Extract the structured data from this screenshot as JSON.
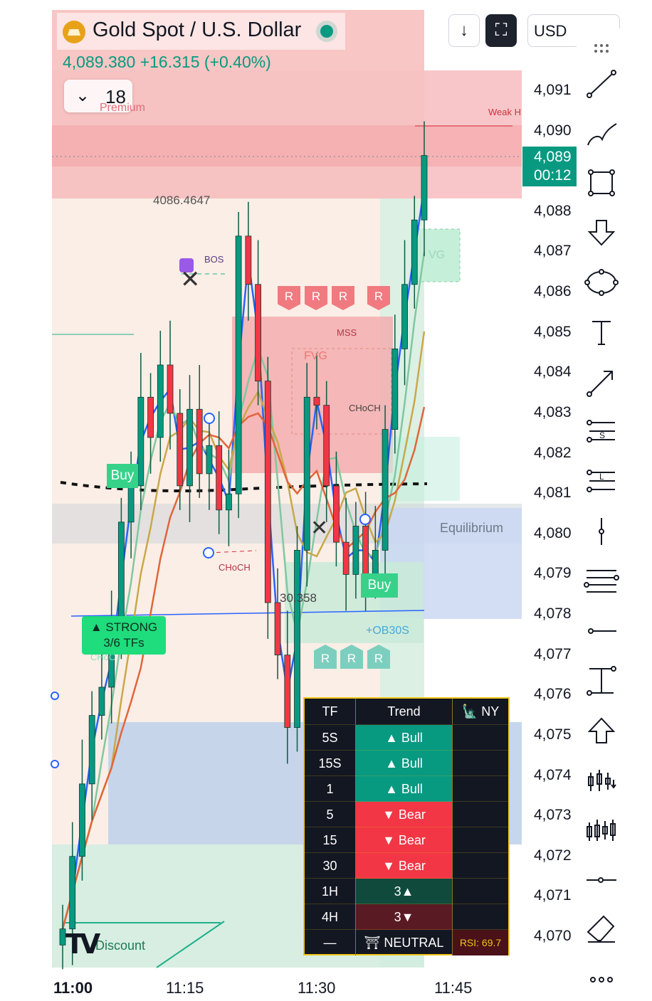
{
  "header": {
    "symbol_title": "Gold Spot / U.S. Dollar",
    "price_line": "4,089.380 +16.315 (+0.40%)",
    "interval": "18",
    "currency": "USD"
  },
  "price_tag": {
    "price": "4,089",
    "countdown": "00:12"
  },
  "colors": {
    "up": "#089981",
    "down": "#f23645",
    "ma_blue": "#2962ff",
    "accent_gold": "#f0c419"
  },
  "chart_data": {
    "type": "candlestick",
    "x_ticks": [
      "11:00",
      "11:15",
      "11:30",
      "11:45"
    ],
    "y_ticks": [
      "4,091",
      "4,090",
      "4,088",
      "4,087",
      "4,086",
      "4,085",
      "4,084",
      "4,083",
      "4,082",
      "4,081",
      "4,080",
      "4,079",
      "4,078",
      "4,077",
      "4,076",
      "4,075",
      "4,074",
      "4,073",
      "4,072",
      "4,071",
      "4,070"
    ],
    "ylim": [
      4069.3,
      4092.0
    ],
    "last_price": 4089.38,
    "close_path": [
      4070.2,
      4072.0,
      4073.8,
      4075.5,
      4076.2,
      4077.5,
      4080.3,
      4081.2,
      4083.4,
      4082.4,
      4084.2,
      4083.0,
      4081.2,
      4083.1,
      4081.5,
      4082.2,
      4080.6,
      4081.0,
      4087.4,
      4086.2,
      4083.8,
      4078.3,
      4077.0,
      4075.2,
      4079.6,
      4083.4,
      4083.2,
      4081.2,
      4079.8,
      4079.0,
      4080.2,
      4079.0,
      4079.6,
      4082.6,
      4084.6,
      4086.2,
      4087.8,
      4089.4
    ],
    "annotations": {
      "high_label": "4086.4647",
      "low_label": "30.358",
      "bos": "BOS",
      "mss": "MSS",
      "fvg_1": "FVG",
      "fvg_2": "VG",
      "choch_1": "CHoCH",
      "choch_2": "CHoCH",
      "choch_3": "CHoC",
      "ob": "+OB",
      "ob_tf": "30S",
      "buy_1": "Buy",
      "buy_2": "Buy",
      "equilibrium": "Equilibrium",
      "weak_high": "Weak H",
      "premium": "Premium",
      "discount": "Discount",
      "strong_line1": "▲ STRONG",
      "strong_line2": "3/6 TFs",
      "r_label": "R"
    }
  },
  "trend_table": {
    "header": {
      "tf": "TF",
      "trend": "Trend",
      "session": "NY"
    },
    "rows": [
      {
        "tf": "5S",
        "trend": "▲ Bull",
        "color": "#089981"
      },
      {
        "tf": "15S",
        "trend": "▲ Bull",
        "color": "#089981"
      },
      {
        "tf": "1",
        "trend": "▲ Bull",
        "color": "#089981"
      },
      {
        "tf": "5",
        "trend": "▼ Bear",
        "color": "#f23645"
      },
      {
        "tf": "15",
        "trend": "▼ Bear",
        "color": "#f23645"
      },
      {
        "tf": "30",
        "trend": "▼ Bear",
        "color": "#f23645"
      },
      {
        "tf": "1H",
        "trend": "3▲",
        "color": "#0f4a3c"
      },
      {
        "tf": "4H",
        "trend": "3▼",
        "color": "#5a1a24"
      }
    ],
    "footer": {
      "tf": "—",
      "trend": "NEUTRAL",
      "rsi": "RSI: 69.7"
    }
  },
  "toolbar": {
    "icons": [
      "drag-handle-icon",
      "trend-line-icon",
      "brush-icon",
      "rectangle-icon",
      "arrow-down-icon",
      "ellipse-icon",
      "text-icon",
      "arrow-line-icon",
      "short-position-icon",
      "long-position-icon",
      "vertical-line-icon",
      "fib-retracement-icon",
      "horizontal-line-icon",
      "measure-icon",
      "arrow-up-icon",
      "volume-profile-icon",
      "candles-icon",
      "horizontal-ray-icon",
      "eraser-icon",
      "more-icon"
    ]
  }
}
